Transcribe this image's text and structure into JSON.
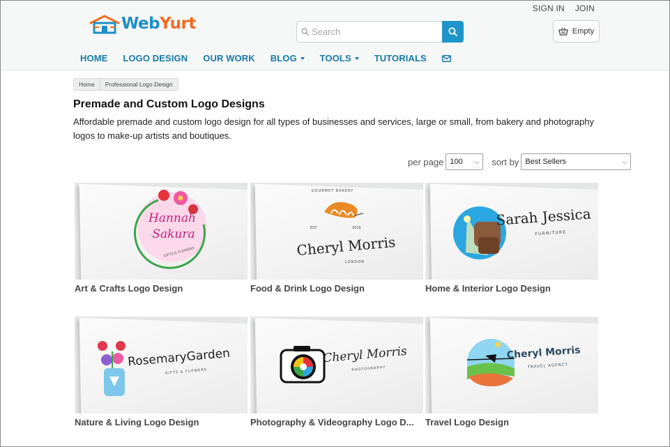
{
  "brand": {
    "name_part1": "Web",
    "name_part2": "Yurt"
  },
  "top_links": {
    "sign_in": "SIGN IN",
    "join": "JOIN"
  },
  "search": {
    "placeholder": "Search"
  },
  "cart": {
    "label": "Empty"
  },
  "nav": [
    {
      "label": "HOME",
      "has_menu": false
    },
    {
      "label": "LOGO DESIGN",
      "has_menu": false
    },
    {
      "label": "OUR WORK",
      "has_menu": false
    },
    {
      "label": "BLOG",
      "has_menu": true
    },
    {
      "label": "TOOLS",
      "has_menu": true
    },
    {
      "label": "TUTORIALS",
      "has_menu": false
    }
  ],
  "breadcrumb": [
    "Home",
    "Professional Logo Design"
  ],
  "page": {
    "title": "Premade and Custom Logo Designs",
    "intro": "Affordable premade and custom logo design for all types of businesses and services, large or small, from bakery and photography logos to make-up artists and boutiques."
  },
  "controls": {
    "per_page_label": "per page",
    "per_page_value": "100",
    "sort_label": "sort by",
    "sort_value": "Best Sellers"
  },
  "categories": [
    {
      "title": "Art & Crafts Logo Design",
      "logo_lines": [
        "Hannah",
        "Sakura",
        "GIFTS & FLOWERS"
      ]
    },
    {
      "title": "Food & Drink Logo Design",
      "logo_lines": [
        "GOURMET BAKERY",
        "EST.",
        "2016",
        "Cheryl Morris",
        "LONDON"
      ]
    },
    {
      "title": "Home & Interior Logo Design",
      "logo_lines": [
        "Sarah Jessica",
        "FURNITURE"
      ]
    },
    {
      "title": "Nature & Living Logo Design",
      "logo_lines": [
        "RosemaryGarden",
        "GIFTS & FLOWERS"
      ]
    },
    {
      "title": "Photography & Videography Logo D...",
      "logo_lines": [
        "Cheryl Morris",
        "PHOTOGRAPHY"
      ]
    },
    {
      "title": "Travel Logo Design",
      "logo_lines": [
        "Cheryl Morris",
        "TRAVEL AGENCY"
      ]
    }
  ],
  "colors": {
    "nav": "#1779a8",
    "accent": "#1e95c9",
    "brand_orange": "#f26b21"
  },
  "icons": {
    "search_button": "search-icon",
    "cart": "basket-icon",
    "nav_email": "envelope-icon",
    "logo": "yurt-icon"
  }
}
